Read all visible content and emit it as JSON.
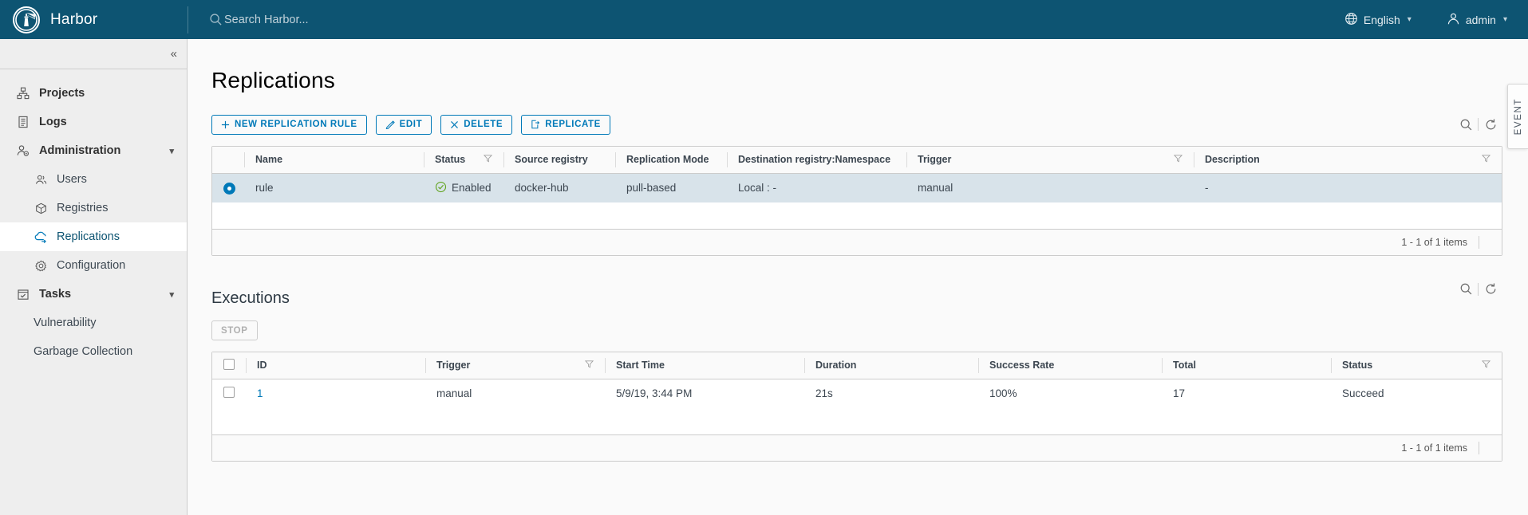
{
  "header": {
    "brand": "Harbor",
    "logo_icon": "harbor-lighthouse-logo",
    "search_icon": "search-icon",
    "search_placeholder": "Search Harbor...",
    "language": {
      "label": "English",
      "icon": "globe-icon",
      "caret": "⌄"
    },
    "user": {
      "label": "admin",
      "icon": "user-icon",
      "caret": "⌄"
    }
  },
  "sidebar": {
    "collapse_icon": "«",
    "items": [
      {
        "label": "Projects",
        "icon": "projects-icon",
        "level": "top",
        "active": false,
        "expandable": false
      },
      {
        "label": "Logs",
        "icon": "logs-icon",
        "level": "top",
        "active": false,
        "expandable": false
      },
      {
        "label": "Administration",
        "icon": "administration-icon",
        "level": "top",
        "active": false,
        "expandable": true
      },
      {
        "label": "Users",
        "icon": "users-icon",
        "level": "sub",
        "active": false,
        "expandable": false
      },
      {
        "label": "Registries",
        "icon": "registries-icon",
        "level": "sub",
        "active": false,
        "expandable": false
      },
      {
        "label": "Replications",
        "icon": "replications-icon",
        "level": "sub",
        "active": true,
        "expandable": false
      },
      {
        "label": "Configuration",
        "icon": "configuration-icon",
        "level": "sub",
        "active": false,
        "expandable": false
      },
      {
        "label": "Tasks",
        "icon": "tasks-icon",
        "level": "top",
        "active": false,
        "expandable": true
      },
      {
        "label": "Vulnerability",
        "icon": "",
        "level": "sub2",
        "active": false,
        "expandable": false
      },
      {
        "label": "Garbage Collection",
        "icon": "",
        "level": "sub2",
        "active": false,
        "expandable": false
      }
    ]
  },
  "page": {
    "title": "Replications",
    "event_tab_label": "EVENT"
  },
  "toolbar": {
    "new_rule_label": "NEW REPLICATION RULE",
    "edit_label": "EDIT",
    "delete_label": "DELETE",
    "replicate_label": "REPLICATE",
    "search_icon": "search-icon",
    "refresh_icon": "refresh-icon"
  },
  "rules_table": {
    "columns": [
      {
        "label": "",
        "filter": false
      },
      {
        "label": "Name",
        "filter": false
      },
      {
        "label": "Status",
        "filter": true
      },
      {
        "label": "Source registry",
        "filter": false
      },
      {
        "label": "Replication Mode",
        "filter": false
      },
      {
        "label": "Destination registry:Namespace",
        "filter": false
      },
      {
        "label": "Trigger",
        "filter": true
      },
      {
        "label": "Description",
        "filter": true
      }
    ],
    "rows": [
      {
        "selected": true,
        "name": "rule",
        "status": "Enabled",
        "status_icon": "check-circle-icon",
        "source_registry": "docker-hub",
        "replication_mode": "pull-based",
        "destination": "Local : -",
        "trigger": "manual",
        "description": "-"
      }
    ],
    "footer_count": "1 - 1 of 1 items"
  },
  "executions": {
    "title": "Executions",
    "stop_label": "STOP",
    "stop_disabled": true,
    "search_icon": "search-icon",
    "refresh_icon": "refresh-icon",
    "columns": [
      {
        "label": "",
        "filter": false
      },
      {
        "label": "ID",
        "filter": false
      },
      {
        "label": "Trigger",
        "filter": true
      },
      {
        "label": "Start Time",
        "filter": false
      },
      {
        "label": "Duration",
        "filter": false
      },
      {
        "label": "Success Rate",
        "filter": false
      },
      {
        "label": "Total",
        "filter": false
      },
      {
        "label": "Status",
        "filter": true
      }
    ],
    "rows": [
      {
        "id": "1",
        "trigger": "manual",
        "start_time": "5/9/19, 3:44 PM",
        "duration": "21s",
        "success_rate": "100%",
        "total": "17",
        "status": "Succeed"
      }
    ],
    "footer_count": "1 - 1 of 1 items"
  },
  "colors": {
    "header_bg": "#0d5472",
    "accent": "#0079b8",
    "selected_row": "#d8e3ea",
    "success_green": "#62a420",
    "sidebar_bg": "#eeeeee"
  }
}
